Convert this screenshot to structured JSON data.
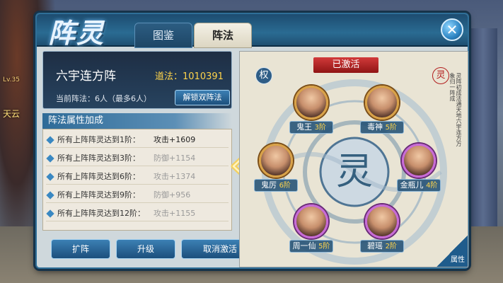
{
  "hud": {
    "level": "Lv.35",
    "player_name": "天云"
  },
  "window": {
    "title": "阵灵",
    "tabs": [
      {
        "label": "图鉴"
      },
      {
        "label": "阵法"
      }
    ],
    "active_tab": "阵法"
  },
  "formation": {
    "name": "六宇连方阵",
    "dao_label": "道法：",
    "dao_value": "1010391",
    "current": "当前阵法：6人（最多6人）",
    "unlock_button": "解锁双阵法"
  },
  "attributes": {
    "header": "阵法属性加成",
    "rows": [
      {
        "cond": "所有上阵阵灵达到1阶：",
        "val": "攻击+1609",
        "active": true
      },
      {
        "cond": "所有上阵阵灵达到3阶：",
        "val": "防御+1154",
        "active": false
      },
      {
        "cond": "所有上阵阵灵达到6阶：",
        "val": "攻击+1374",
        "active": false
      },
      {
        "cond": "所有上阵阵灵达到9阶：",
        "val": "防御+956",
        "active": false
      },
      {
        "cond": "所有上阵阵灵达到12阶：",
        "val": "攻击+1155",
        "active": false
      }
    ]
  },
  "buttons": {
    "expand": "扩阵",
    "upgrade": "升级",
    "cancel": "取消激活",
    "info": "!"
  },
  "board": {
    "status": "已激活",
    "seal_left": "权",
    "seal_right": "灵",
    "center_glyph": "灵",
    "calligraphy": "灵阵初成法通天地六宇连方万象归一阵成",
    "corner_label": "属性",
    "heroes": [
      {
        "name": "鬼王",
        "level": "3阶",
        "theme": "gold"
      },
      {
        "name": "毒神",
        "level": "5阶",
        "theme": "gold"
      },
      {
        "name": "鬼厉",
        "level": "6阶",
        "theme": "gold"
      },
      {
        "name": "金瓶儿",
        "level": "4阶",
        "theme": "pink"
      },
      {
        "name": "周一仙",
        "level": "5阶",
        "theme": "pink"
      },
      {
        "name": "碧瑶",
        "level": "2阶",
        "theme": "pink"
      }
    ]
  },
  "colors": {
    "accent": "#2f6f98",
    "active_red": "#c02828",
    "gold": "#ffd44a"
  }
}
